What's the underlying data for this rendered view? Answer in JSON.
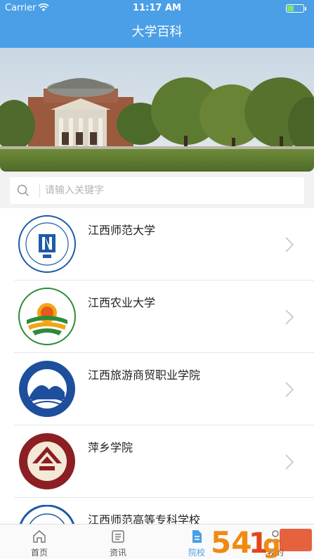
{
  "status_bar": {
    "carrier": "Carrier",
    "time": "11:17 AM"
  },
  "nav": {
    "title": "大学百科"
  },
  "search": {
    "placeholder": "请输入关键字"
  },
  "schools": [
    {
      "name": "江西师范大学",
      "logo": "jxnu-logo"
    },
    {
      "name": "江西农业大学",
      "logo": "jxau-logo"
    },
    {
      "name": "江西旅游商贸职业学院",
      "logo": "jxtcvc-logo"
    },
    {
      "name": "萍乡学院",
      "logo": "pxu-logo"
    },
    {
      "name": "江西师范高等专科学校",
      "logo": "jxnc-logo"
    }
  ],
  "tabs": [
    {
      "label": "首页",
      "icon": "home-icon"
    },
    {
      "label": "资讯",
      "icon": "news-icon"
    },
    {
      "label": "院校",
      "icon": "school-icon",
      "active": true
    },
    {
      "label": "我的",
      "icon": "user-icon"
    }
  ],
  "colors": {
    "primary": "#4a9fe6",
    "background": "#f2f2f2"
  }
}
